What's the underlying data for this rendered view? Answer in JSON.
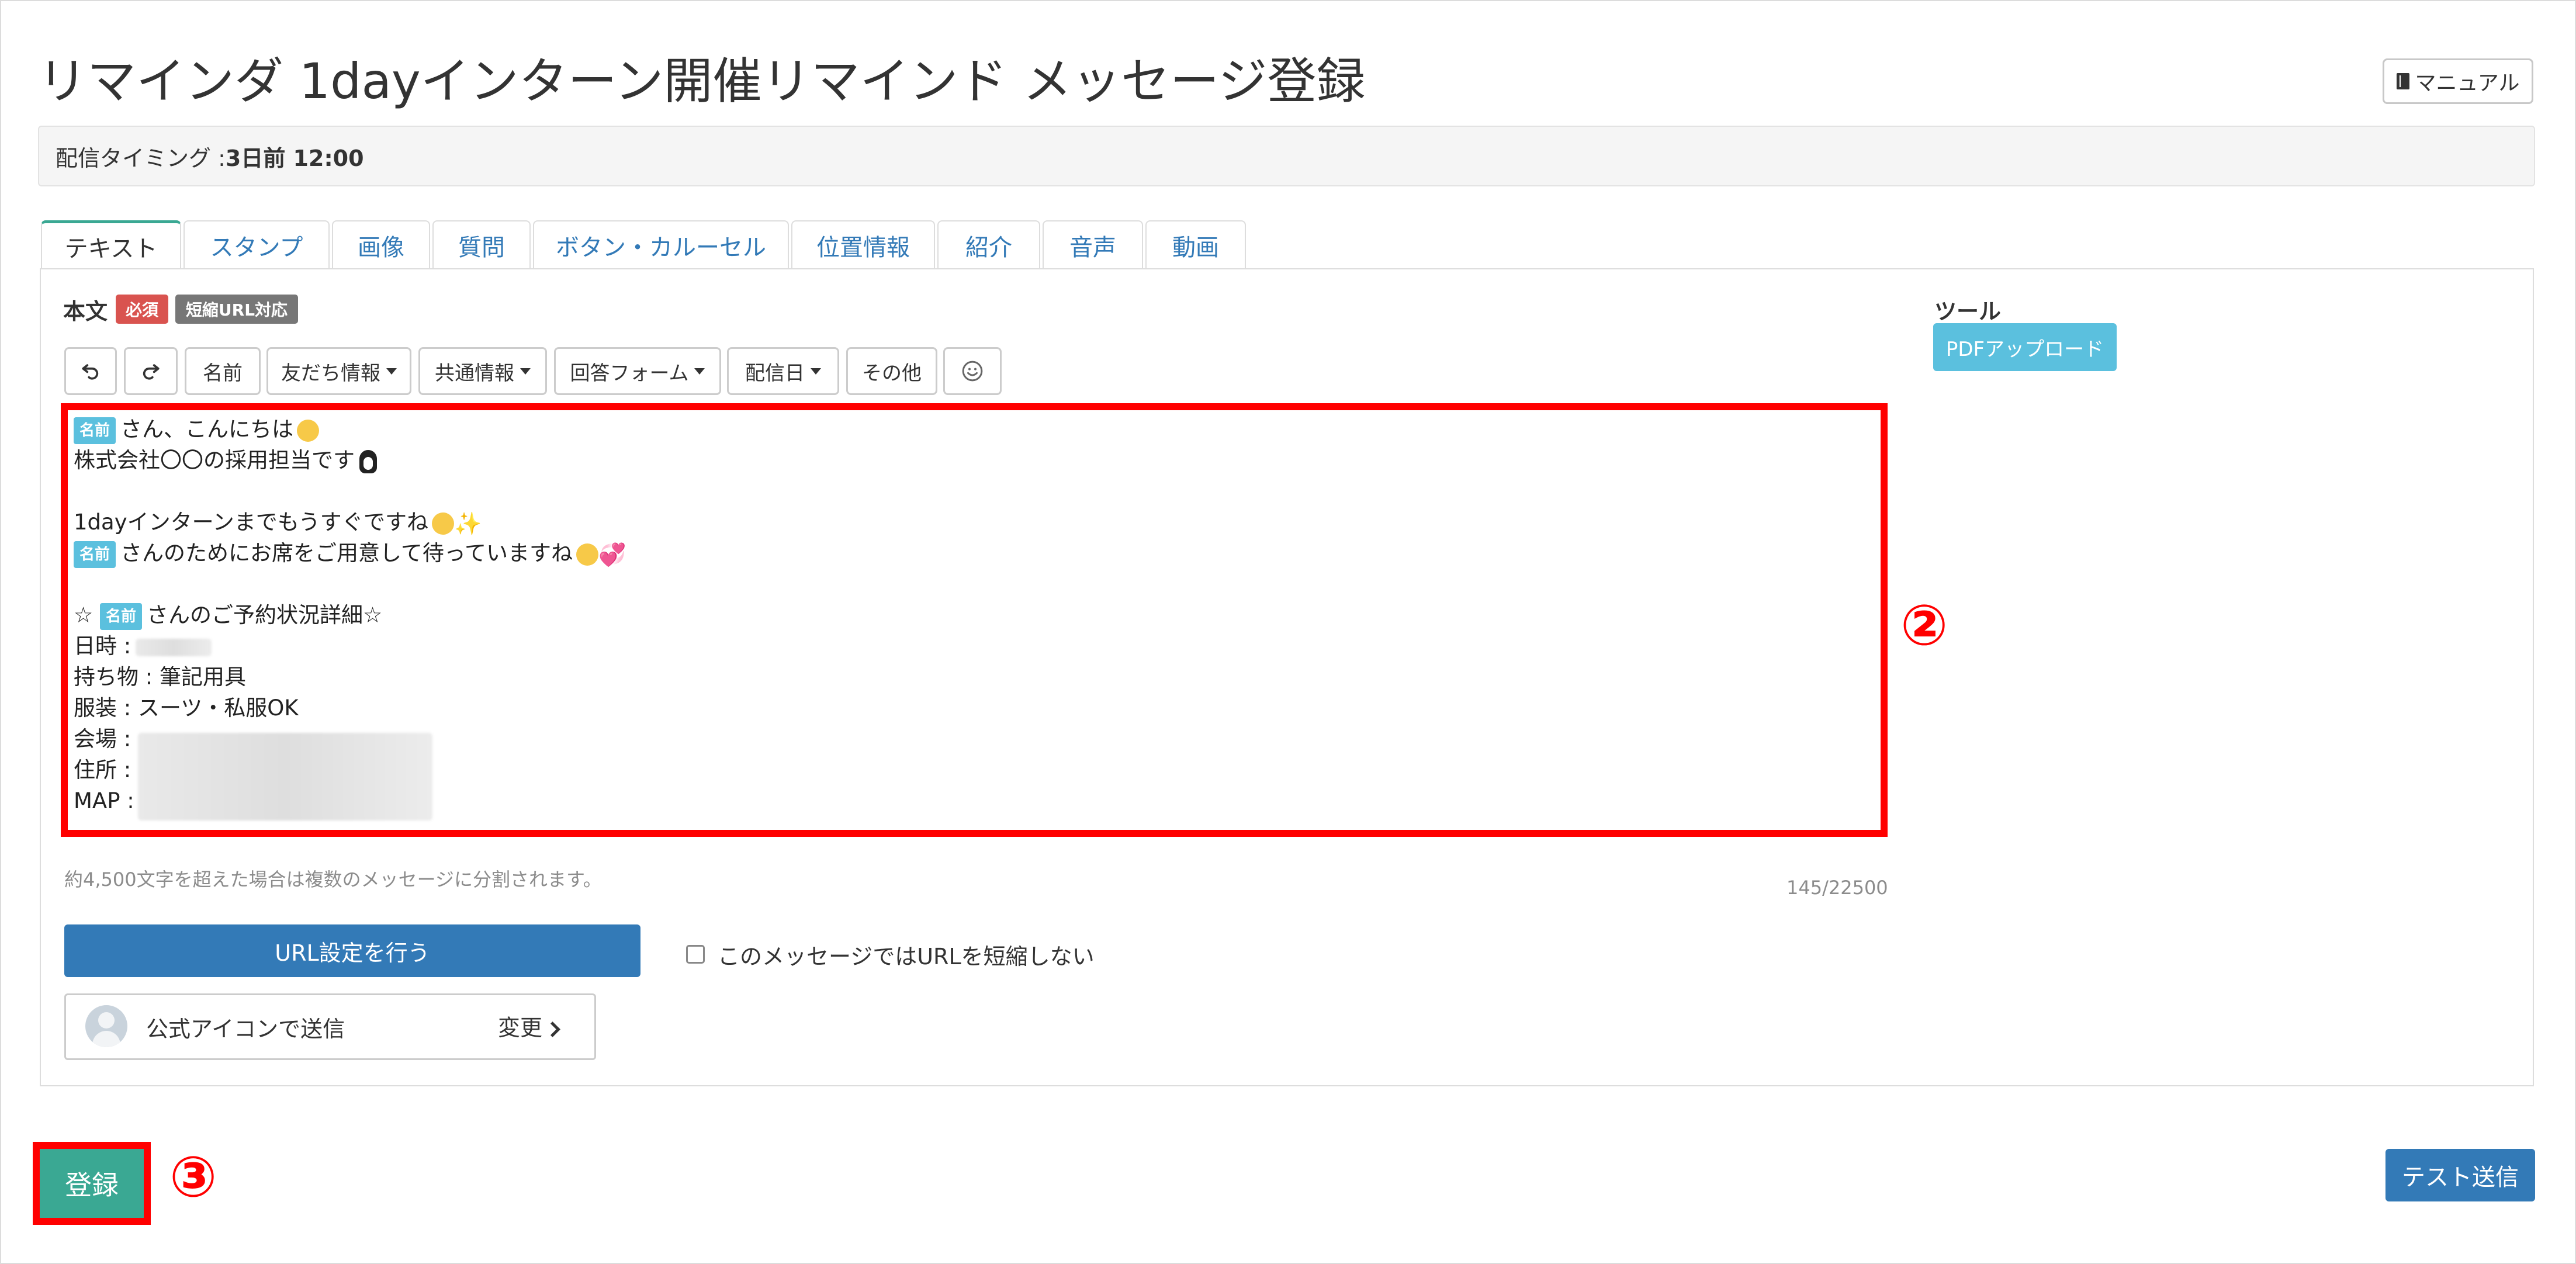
{
  "header": {
    "title": "リマインダ 1dayインターン開催リマインド メッセージ登録",
    "manual_label": "マニュアル"
  },
  "timing": {
    "label": "配信タイミング : ",
    "value": "3日前 12:00"
  },
  "tabs": [
    {
      "label": "テキスト",
      "active": true
    },
    {
      "label": "スタンプ"
    },
    {
      "label": "画像"
    },
    {
      "label": "質問"
    },
    {
      "label": "ボタン・カルーセル"
    },
    {
      "label": "位置情報"
    },
    {
      "label": "紹介"
    },
    {
      "label": "音声"
    },
    {
      "label": "動画"
    }
  ],
  "body_field": {
    "label": "本文",
    "required_badge": "必須",
    "short_url_badge": "短縮URL対応"
  },
  "toolbar": {
    "undo_icon": "undo-icon",
    "redo_icon": "redo-icon",
    "name": "名前",
    "friend_info": "友だち情報",
    "common_info": "共通情報",
    "answer_form": "回答フォーム",
    "delivery_date": "配信日",
    "other": "その他",
    "emoji_icon": "smiley-icon"
  },
  "editor": {
    "name_tag": "名前",
    "lines": {
      "l1": "さん、こんにちは",
      "l2": "株式会社〇〇の採用担当です",
      "l3": "1dayインターンまでもうすぐですね",
      "l4": "さんのためにお席をご用意して待っていますね",
      "l5_prefix": "☆",
      "l5": "さんのご予約状況詳細☆",
      "l6": "日時 :",
      "l7": "持ち物 : 筆記用具",
      "l8": "服装 : スーツ・私服OK",
      "l9": "会場 :",
      "l10": "住所 :",
      "l11": "MAP :"
    }
  },
  "annotations": {
    "marker_2": "②",
    "marker_3": "③"
  },
  "note": "約4,500文字を超えた場合は複数のメッセージに分割されます。",
  "counter": "145/22500",
  "tools": {
    "label": "ツール",
    "pdf_upload": "PDFアップロード"
  },
  "url_settings_button": "URL設定を行う",
  "no_shorten_checkbox": {
    "label": "このメッセージではURLを短縮しない",
    "checked": false
  },
  "sender": {
    "label": "公式アイコンで送信",
    "change": "変更"
  },
  "footer": {
    "register": "登録",
    "test_send": "テスト送信"
  },
  "colors": {
    "accent_green": "#3aa893",
    "primary_blue": "#337ab7",
    "info_cyan": "#5bc0de",
    "danger_red": "#d9534f",
    "highlight_red": "#ff0000"
  }
}
